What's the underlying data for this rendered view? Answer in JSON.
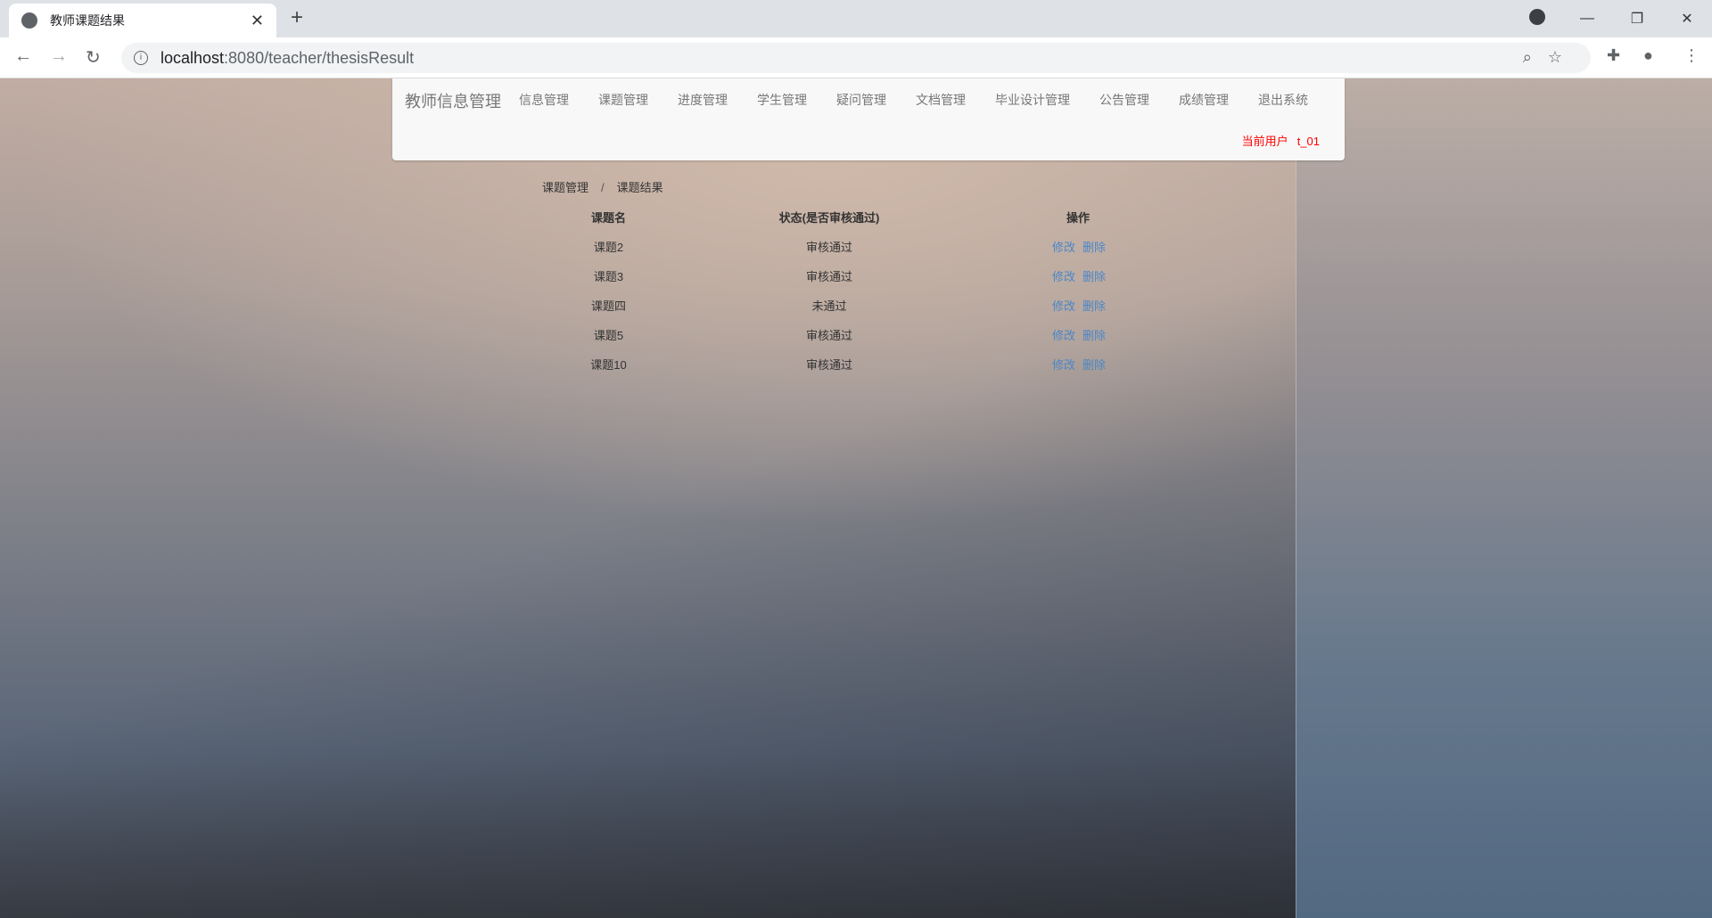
{
  "browser": {
    "tab_title": "教师课题结果",
    "url_host": "localhost",
    "url_path": ":8080/teacher/thesisResult"
  },
  "navbar": {
    "brand": "教师信息管理",
    "items": [
      "信息管理",
      "课题管理",
      "进度管理",
      "学生管理",
      "疑问管理",
      "文档管理",
      "毕业设计管理",
      "公告管理",
      "成绩管理",
      "退出系统"
    ],
    "user_label": "当前用户",
    "user_name": "t_01"
  },
  "breadcrumb": {
    "parent": "课题管理",
    "separator": "/",
    "current": "课题结果"
  },
  "table": {
    "headers": [
      "课题名",
      "状态(是否审核通过)",
      "操作"
    ],
    "rows": [
      {
        "name": "课题2",
        "status": "审核通过",
        "edit": "修改",
        "delete": "删除"
      },
      {
        "name": "课题3",
        "status": "审核通过",
        "edit": "修改",
        "delete": "删除"
      },
      {
        "name": "课题四",
        "status": "未通过",
        "edit": "修改",
        "delete": "删除"
      },
      {
        "name": "课题5",
        "status": "审核通过",
        "edit": "修改",
        "delete": "删除"
      },
      {
        "name": "课题10",
        "status": "审核通过",
        "edit": "修改",
        "delete": "删除"
      }
    ]
  },
  "colors": {
    "link": "#4a86c8",
    "user": "#ff0000"
  }
}
